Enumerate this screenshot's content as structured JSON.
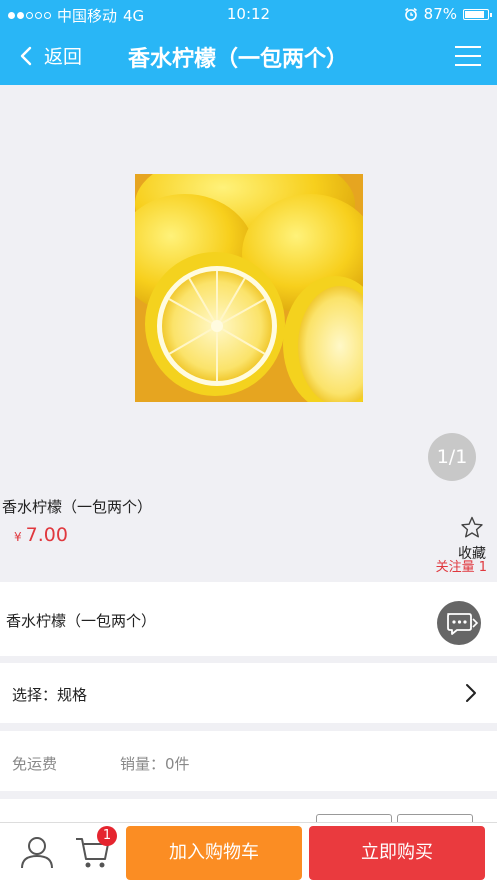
{
  "status_bar": {
    "carrier": "中国移动",
    "network": "4G",
    "time": "10:12",
    "battery": "87%",
    "battery_level": 0.87,
    "signal_bars_filled": 2,
    "signal_bars_total": 5
  },
  "nav": {
    "back_label": "返回",
    "title": "香水柠檬（一包两个）"
  },
  "gallery": {
    "counter": "1/1"
  },
  "product": {
    "name": "香水柠檬（一包两个）",
    "currency": "¥",
    "price": "7.00",
    "favorite_label": "收藏",
    "follow_label": "关注量",
    "follow_count": "1"
  },
  "description": {
    "text": "香水柠檬（一包两个）"
  },
  "select": {
    "label": "选择：规格"
  },
  "meta": {
    "shipping": "免运费",
    "sales": "销量：0件"
  },
  "bottom_bar": {
    "cart_count": "1",
    "add_to_cart_label": "加入购物车",
    "buy_now_label": "立即购买"
  },
  "colors": {
    "header_blue": "#29b6f6",
    "price_red": "#e0383e",
    "cart_orange": "#fb8d23",
    "buy_red": "#ea3a3e"
  },
  "icons": [
    "back-arrow-icon",
    "menu-icon",
    "star-icon",
    "chat-icon",
    "chevron-right-icon",
    "user-icon",
    "cart-icon",
    "alarm-icon",
    "battery-icon"
  ]
}
